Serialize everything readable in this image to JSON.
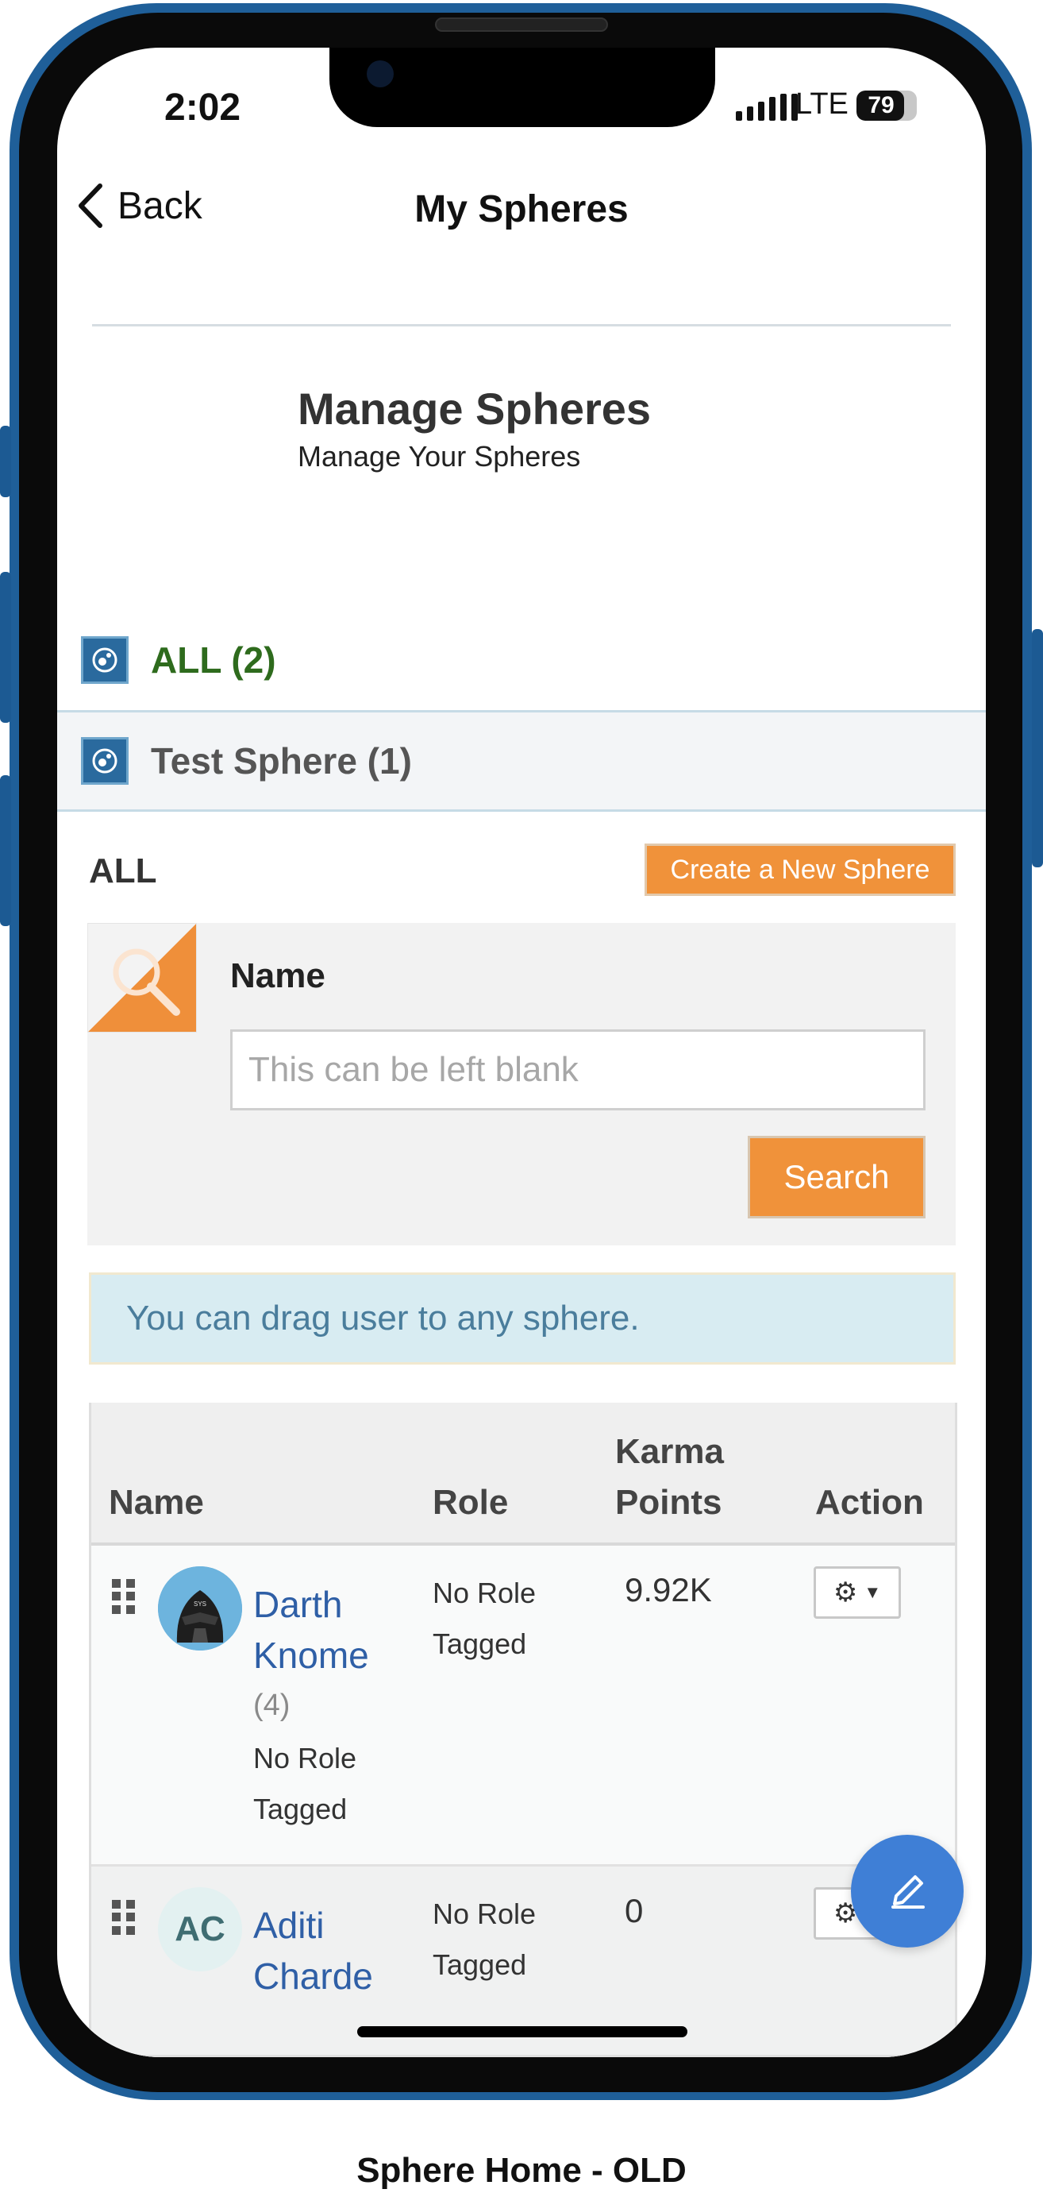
{
  "status_bar": {
    "time": "2:02",
    "network": "LTE",
    "battery": "79",
    "battery_level": 0.79
  },
  "nav": {
    "back_label": "Back",
    "title": "My Spheres"
  },
  "header": {
    "title": "Manage Spheres",
    "subtitle": "Manage Your Spheres"
  },
  "spheres": [
    {
      "label": "ALL (2)",
      "color": "#2e6b1d"
    },
    {
      "label": "Test Sphere (1)",
      "color": "#555555"
    }
  ],
  "section": {
    "heading": "ALL",
    "create_button": "Create a New Sphere"
  },
  "search": {
    "label": "Name",
    "placeholder": "This can be left blank",
    "value": "",
    "button": "Search"
  },
  "info_banner": "You can drag user to any sphere.",
  "table": {
    "columns": {
      "name": "Name",
      "role": "Role",
      "karma_line1": "Karma",
      "karma_line2": "Points",
      "action": "Action"
    },
    "rows": [
      {
        "name_line1": "Darth",
        "name_line2": "Knome",
        "count": "(4)",
        "sub_role_line1": "No Role",
        "sub_role_line2": "Tagged",
        "role_line1": "No Role",
        "role_line2": "Tagged",
        "karma": "9.92K",
        "avatar": "darth-vader-avatar"
      },
      {
        "name_line1": "Aditi",
        "name_line2": "Charde",
        "initials": "AC",
        "role_line1": "No Role",
        "role_line2": "Tagged",
        "karma": "0"
      }
    ]
  },
  "caption": "Sphere Home - OLD",
  "colors": {
    "accent_orange": "#f0923a",
    "link_blue": "#2f5fa6",
    "fab_blue": "#3f7fd6",
    "phone_blue": "#1f5f99"
  }
}
